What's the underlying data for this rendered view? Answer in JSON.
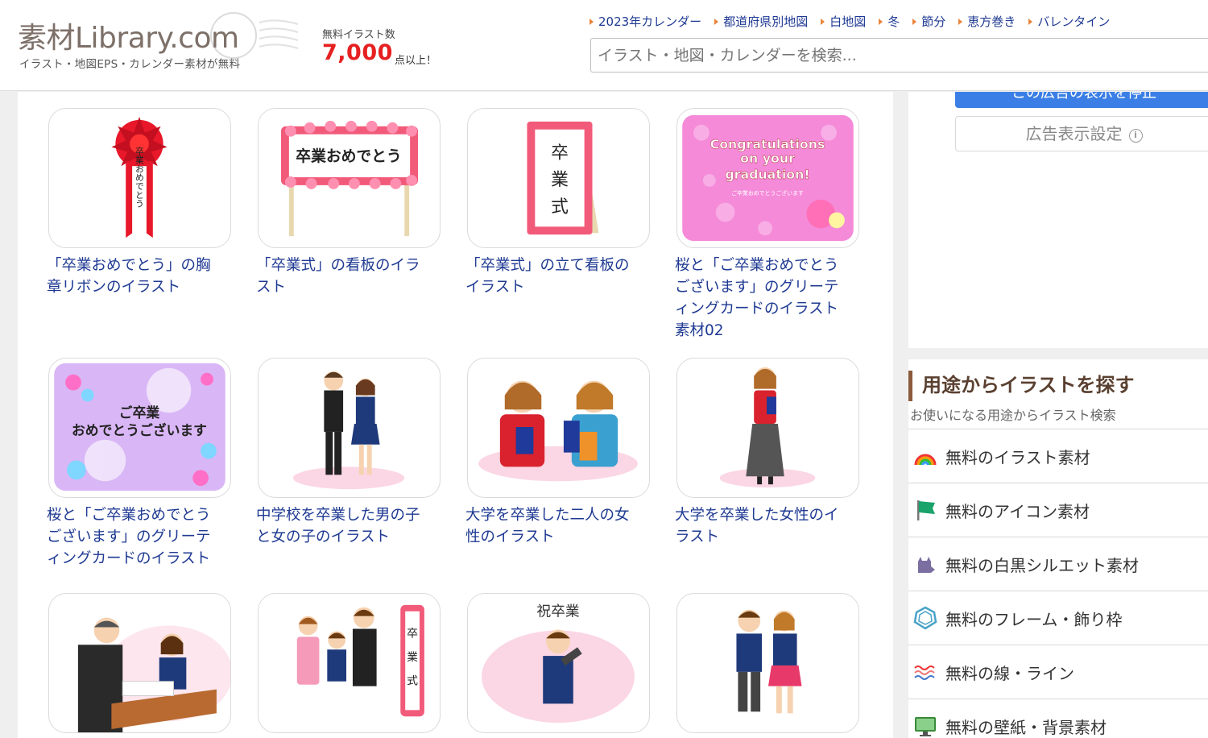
{
  "header": {
    "logo_main": "素材Library.com",
    "logo_sub": "イラスト・地図EPS・カレンダー素材が無料",
    "count_label": "無料イラスト数",
    "count_value": "7,000",
    "count_suffix": "点以上！",
    "nav": [
      {
        "label": "2023年カレンダー"
      },
      {
        "label": "都道府県別地図"
      },
      {
        "label": "白地図"
      },
      {
        "label": "冬"
      },
      {
        "label": "節分"
      },
      {
        "label": "恵方巻き"
      },
      {
        "label": "バレンタイン"
      }
    ],
    "search_placeholder": "イラスト・地図・カレンダーを検索..."
  },
  "cards": [
    {
      "title": "「卒業おめでとう」の胸章リボンのイラスト",
      "thumb_text": "卒業おめでとう"
    },
    {
      "title": "「卒業式」の看板のイラスト",
      "thumb_text": "卒業おめでとう"
    },
    {
      "title": "「卒業式」の立て看板のイラスト",
      "thumb_text": "卒業式"
    },
    {
      "title": "桜と「ご卒業おめでとうございます」のグリーティングカードのイラスト素材02",
      "thumb_text": "Congratulations on your graduation!",
      "thumb_text_small": "ご卒業おめでとうございます"
    },
    {
      "title": "桜と「ご卒業おめでとうございます」のグリーティングカードのイラスト",
      "thumb_text": "ご卒業",
      "thumb_text2": "おめでとうございます"
    },
    {
      "title": "中学校を卒業した男の子と女の子のイラスト"
    },
    {
      "title": "大学を卒業した二人の女性のイラスト"
    },
    {
      "title": "大学を卒業した女性のイラスト"
    },
    {
      "title": ""
    },
    {
      "title": "",
      "thumb_text": "卒業式"
    },
    {
      "title": "",
      "thumb_text": "祝卒業"
    },
    {
      "title": ""
    }
  ],
  "ad": {
    "button_label": "この広告の表示を停止",
    "settings_label": "広告表示設定",
    "info_glyph": "i"
  },
  "sidebar": {
    "heading": "用途からイラストを探す",
    "subheading": "お使いになる用途からイラスト検索",
    "items": [
      {
        "label": "無料のイラスト素材",
        "icon": "rainbow-icon"
      },
      {
        "label": "無料のアイコン素材",
        "icon": "flag-icon"
      },
      {
        "label": "無料の白黒シルエット素材",
        "icon": "cat-silhouette-icon"
      },
      {
        "label": "無料のフレーム・飾り枠",
        "icon": "frame-icon"
      },
      {
        "label": "無料の線・ライン",
        "icon": "wavy-line-icon"
      },
      {
        "label": "無料の壁紙・背景素材",
        "icon": "monitor-icon"
      }
    ]
  },
  "colors": {
    "link": "#1f3a93",
    "count": "#e62020",
    "nav_arrow": "#e8843a",
    "heading_bar": "#8b5a3c"
  }
}
